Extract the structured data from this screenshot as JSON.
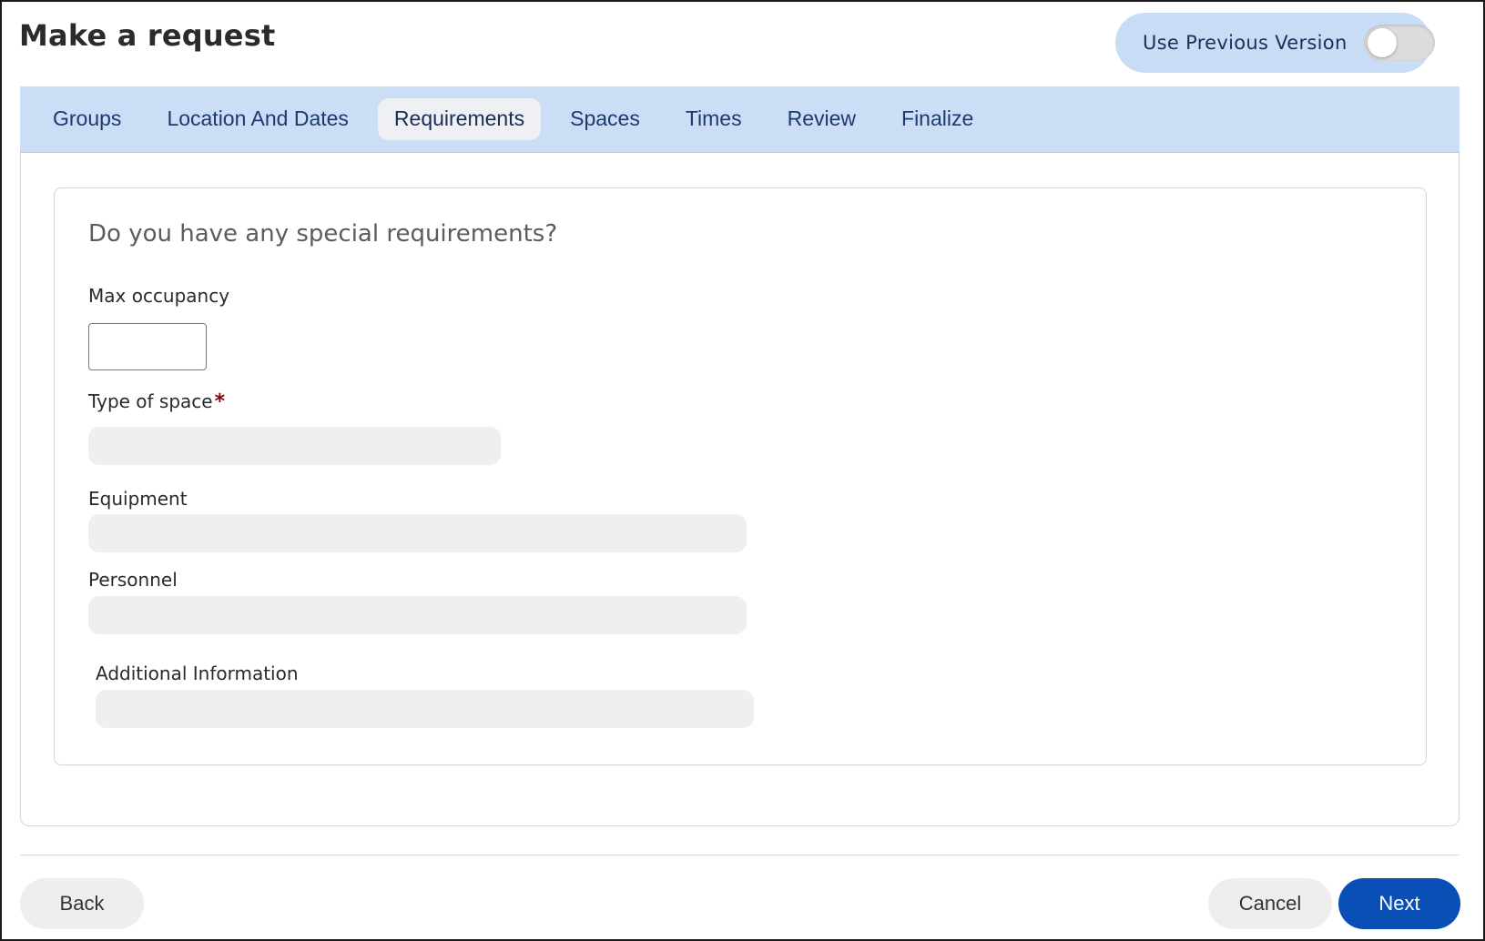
{
  "header": {
    "title": "Make a request",
    "toggle_label": "Use Previous Version",
    "toggle_on": false
  },
  "tabs": [
    {
      "label": "Groups",
      "active": false
    },
    {
      "label": "Location And Dates",
      "active": false
    },
    {
      "label": "Requirements",
      "active": true
    },
    {
      "label": "Spaces",
      "active": false
    },
    {
      "label": "Times",
      "active": false
    },
    {
      "label": "Review",
      "active": false
    },
    {
      "label": "Finalize",
      "active": false
    }
  ],
  "form": {
    "heading": "Do you have any special requirements?",
    "max_occupancy": {
      "label": "Max occupancy",
      "value": ""
    },
    "type_of_space": {
      "label": "Type of space",
      "required_mark": "*",
      "value": ""
    },
    "equipment": {
      "label": "Equipment",
      "value": ""
    },
    "personnel": {
      "label": "Personnel",
      "value": ""
    },
    "additional_information": {
      "label": "Additional Information",
      "value": ""
    }
  },
  "footer": {
    "back_label": "Back",
    "cancel_label": "Cancel",
    "next_label": "Next"
  },
  "colors": {
    "tabbar_bg": "#ccdef5",
    "toggle_bg": "#c8dcf5",
    "primary_button": "#0a4fb5",
    "required_star": "#8b0000"
  }
}
